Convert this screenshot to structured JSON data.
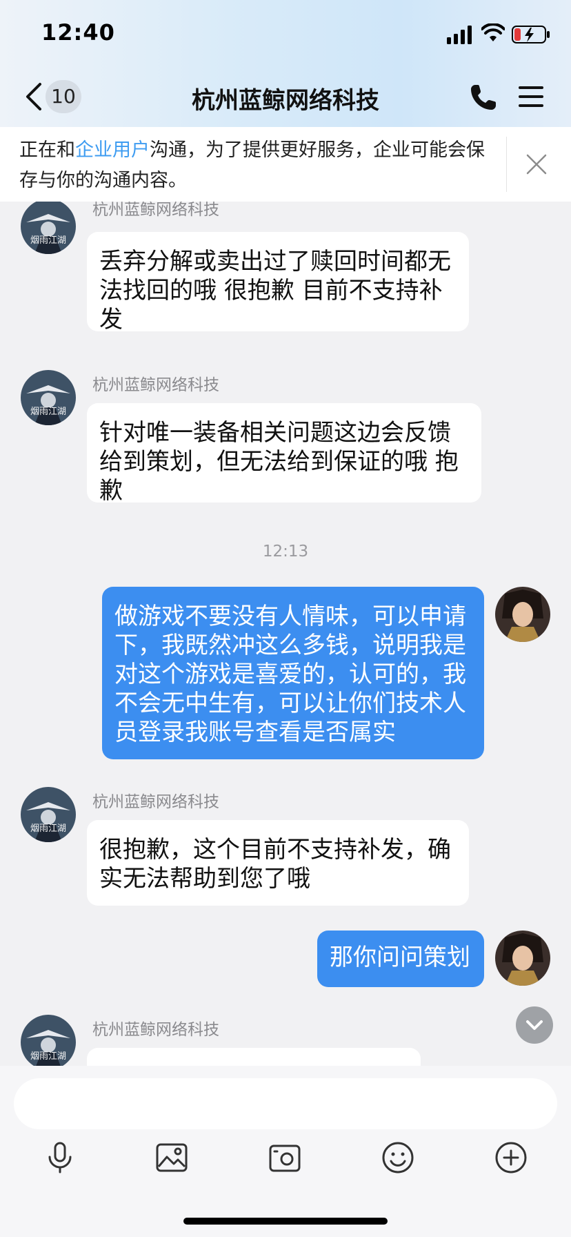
{
  "status": {
    "time": "12:40"
  },
  "nav": {
    "badge": "10",
    "title": "杭州蓝鲸网络科技"
  },
  "notice": {
    "prefix": "正在和",
    "link": "企业用户",
    "suffix": "沟通，为了提供更好服务，企业可能会保存与你的沟通内容。"
  },
  "messages": [
    {
      "side": "in",
      "sender": "杭州蓝鲸网络科技",
      "text": "丢弃分解或卖出过了赎回时间都无法找回的哦 很抱歉 目前不支持补发"
    },
    {
      "side": "in",
      "sender": "杭州蓝鲸网络科技",
      "text": "针对唯一装备相关问题这边会反馈给到策划，但无法给到保证的哦 抱歉"
    },
    {
      "side": "time",
      "text": "12:13"
    },
    {
      "side": "out",
      "text": "做游戏不要没有人情味，可以申请下，我既然冲这么多钱，说明我是对这个游戏是喜爱的，认可的，我不会无中生有，可以让你们技术人员登录我账号查看是否属实"
    },
    {
      "side": "in",
      "sender": "杭州蓝鲸网络科技",
      "text": "很抱歉，这个目前不支持补发，确实无法帮助到您了哦"
    },
    {
      "side": "out",
      "text": "那你问问策划"
    },
    {
      "side": "in",
      "sender": "杭州蓝鲸网络科技",
      "text": ""
    }
  ],
  "avatar_labels": {
    "left": "烟雨江湖"
  },
  "icons": {
    "back": "chevron-left-icon",
    "phone": "phone-icon",
    "menu": "hamburger-menu-icon",
    "close": "close-icon",
    "scroll_down": "chevron-down-icon",
    "voice": "microphone-icon",
    "image": "image-icon",
    "camera": "camera-icon",
    "emoji": "emoji-icon",
    "more": "plus-circle-icon"
  },
  "colors": {
    "accent": "#3c8ef0",
    "link": "#3e9cf1",
    "background": "#f1f1f3"
  }
}
